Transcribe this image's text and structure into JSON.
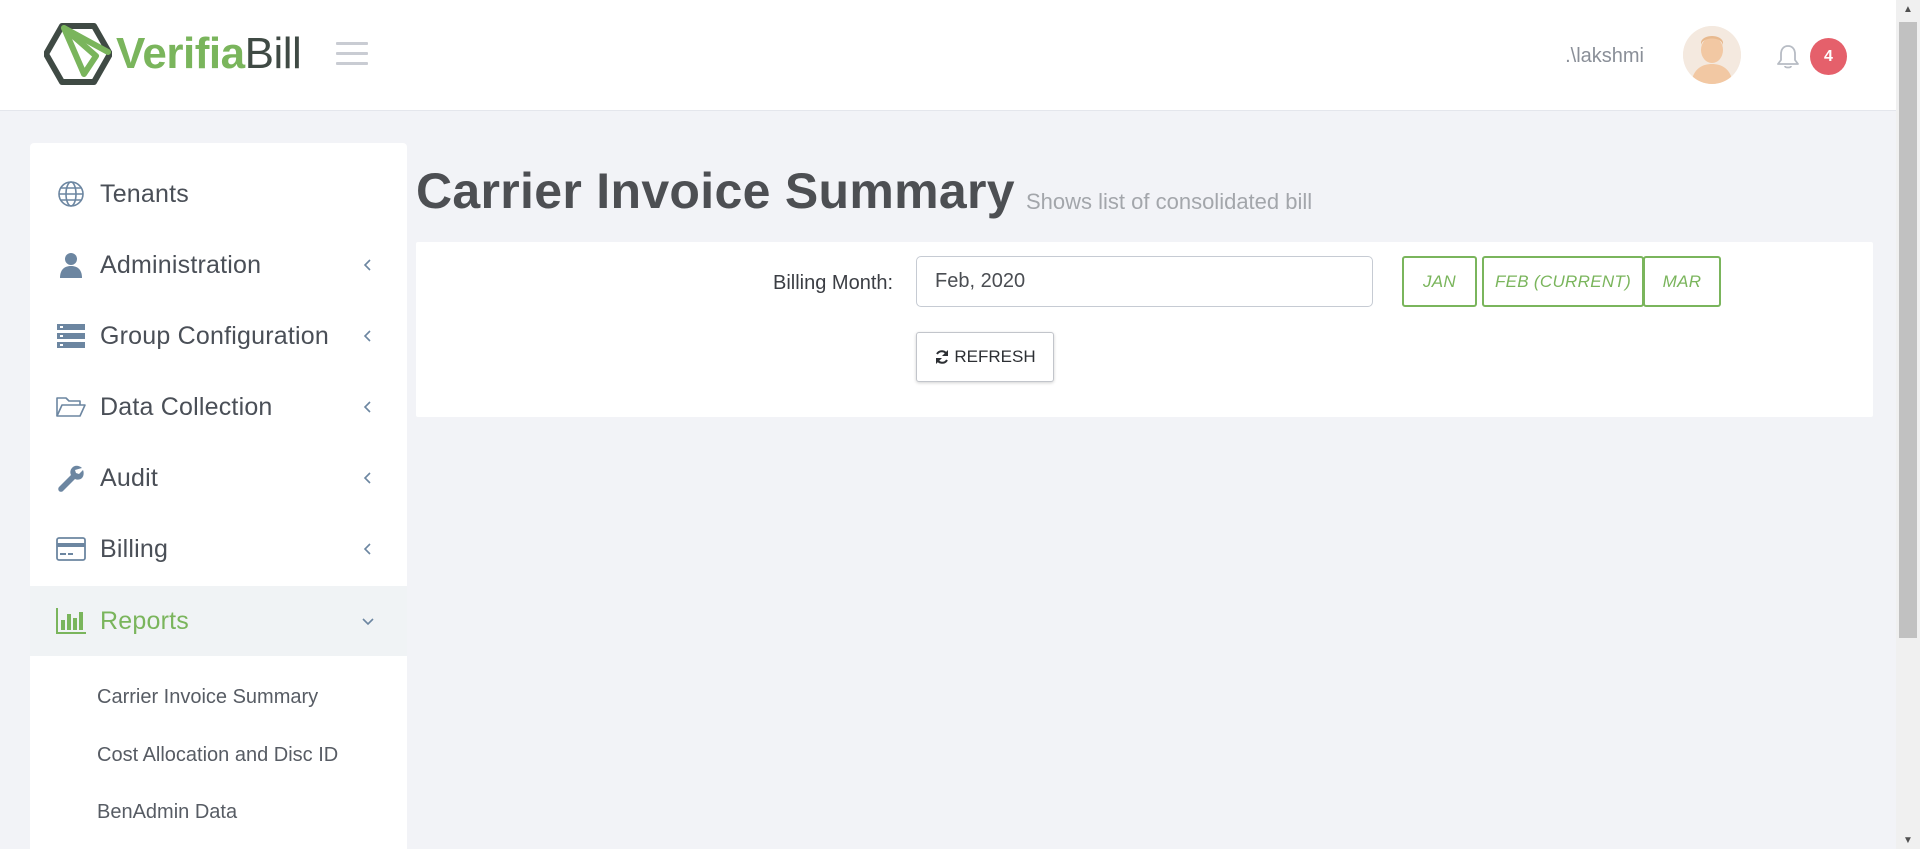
{
  "header": {
    "logo_part1": "Verifia",
    "logo_part2": "Bill",
    "user_name": ".\\lakshmi",
    "notification_count": "4"
  },
  "sidebar": {
    "items": [
      {
        "label": "Tenants",
        "icon": "globe-icon",
        "has_chevron": false
      },
      {
        "label": "Administration",
        "icon": "user-icon",
        "has_chevron": true
      },
      {
        "label": "Group Configuration",
        "icon": "server-icon",
        "has_chevron": true
      },
      {
        "label": "Data Collection",
        "icon": "folder-open-icon",
        "has_chevron": true
      },
      {
        "label": "Audit",
        "icon": "wrench-icon",
        "has_chevron": true
      },
      {
        "label": "Billing",
        "icon": "credit-card-icon",
        "has_chevron": true
      },
      {
        "label": "Reports",
        "icon": "bar-chart-icon",
        "has_chevron": true,
        "expanded": true
      }
    ],
    "sub_items": [
      {
        "label": "Carrier Invoice Summary"
      },
      {
        "label": "Cost Allocation and Disc ID"
      },
      {
        "label": "BenAdmin Data"
      }
    ]
  },
  "main": {
    "title": "Carrier Invoice Summary",
    "subtitle": "Shows list of consolidated bill",
    "billing_month_label": "Billing Month:",
    "billing_month_value": "Feb, 2020",
    "month_buttons": [
      "JAN",
      "FEB (CURRENT)",
      "MAR"
    ],
    "refresh_label": "REFRESH"
  },
  "colors": {
    "accent": "#7ab55c",
    "badge": "#e5606b",
    "background": "#f2f3f7",
    "icon": "#6c86a1"
  }
}
